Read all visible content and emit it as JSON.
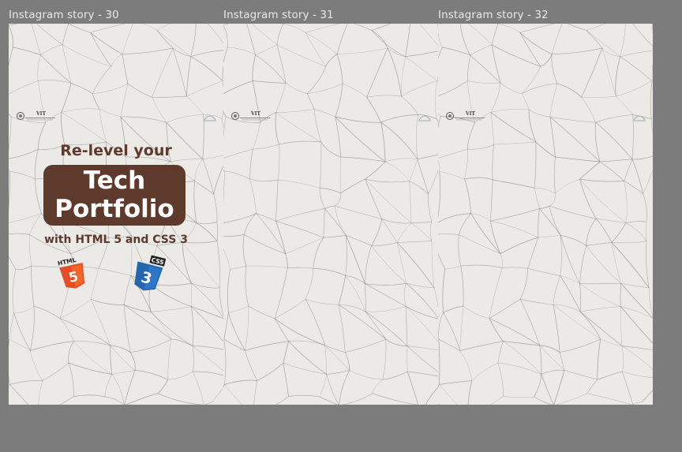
{
  "frames": [
    {
      "label": "Instagram story - 30",
      "headline_top": "Re-level your",
      "box_line1": "Tech",
      "box_line2": "Portfolio",
      "subline": "with HTML 5 and CSS 3",
      "html_badge_text": "HTML",
      "html_badge_number": "5",
      "css_badge_text": "CSS",
      "css_badge_number": "3",
      "logo_text": "VIT"
    },
    {
      "label": "Instagram story - 31",
      "logo_text": "VIT"
    },
    {
      "label": "Instagram story - 32",
      "logo_text": "VIT"
    }
  ],
  "colors": {
    "canvas": "#7c7c7c",
    "brown": "#5e3a2c",
    "html_orange": "#e44d26",
    "css_blue": "#2565ae"
  }
}
